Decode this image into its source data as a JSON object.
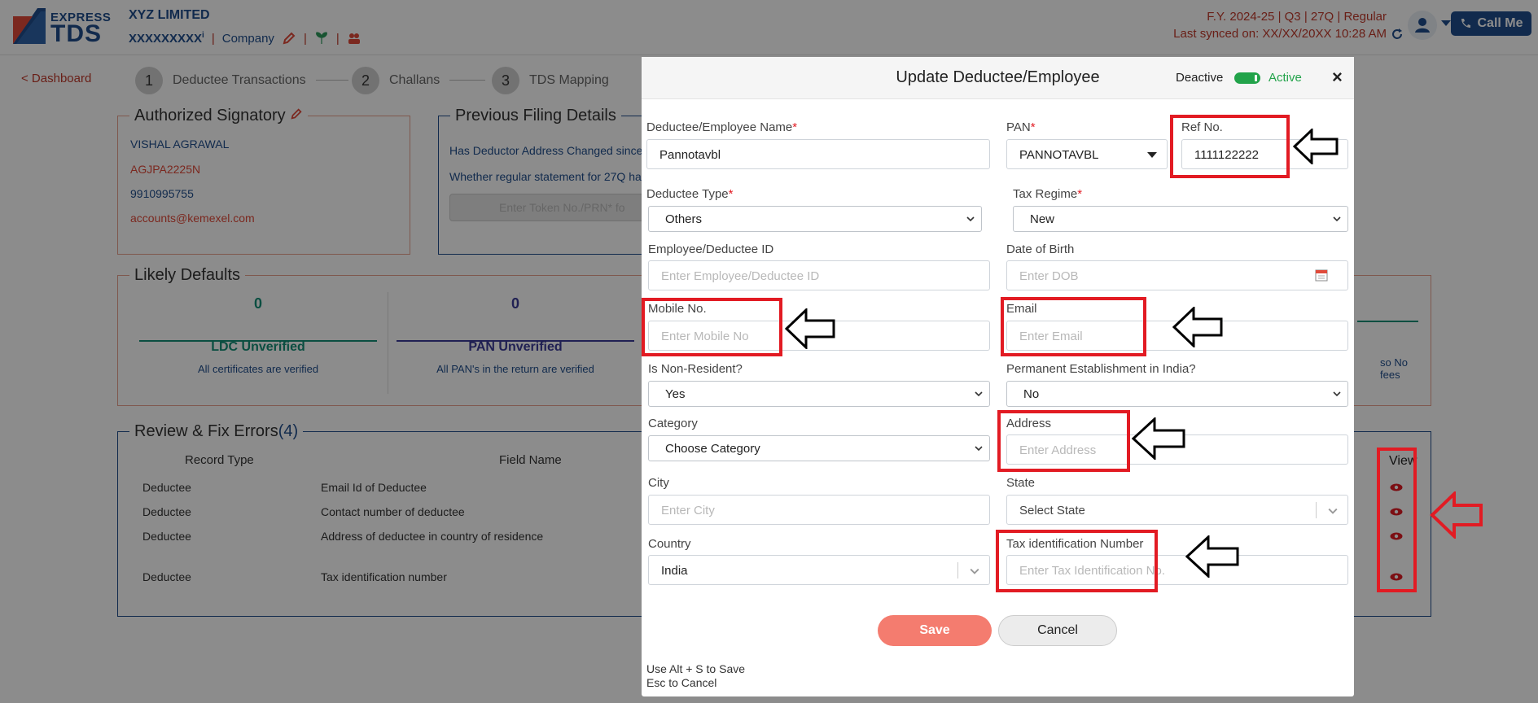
{
  "header": {
    "logo_top": "EXPRESS",
    "logo_bottom": "TDS",
    "company_name": "XYZ LIMITED",
    "tan": "XXXXXXXXX",
    "tan_sup": "i",
    "company_link": "Company",
    "fy_info": "F.Y. 2024-25  | Q3  | 27Q | Regular",
    "last_synced": "Last synced on: XX/XX/20XX 10:28 AM",
    "call_me": "Call Me"
  },
  "nav": {
    "back": "< Dashboard",
    "steps": [
      {
        "num": "1",
        "label": "Deductee Transactions"
      },
      {
        "num": "2",
        "label": "Challans"
      },
      {
        "num": "3",
        "label": "TDS Mapping"
      }
    ]
  },
  "authorized": {
    "title": "Authorized Signatory",
    "name": "VISHAL AGRAWAL",
    "pan": "AGJPA2225N",
    "phone": "9910995755",
    "email": "accounts@kemexel.com"
  },
  "previous": {
    "title": "Previous Filing Details",
    "q1": "Has Deductor Address Changed since",
    "q2": "Whether regular statement for 27Q ha",
    "token_placeholder": "Enter Token No./PRN* fo"
  },
  "likely": {
    "title": "Likely Defaults",
    "stats": [
      {
        "count": "0",
        "title": "LDC Unverified",
        "desc": "All certificates are verified",
        "color": "#148f77"
      },
      {
        "count": "0",
        "title": "PAN Unverified",
        "desc": "All PAN's in the return are verified",
        "color": "#3b3b98"
      }
    ],
    "right_fragment": "so No fees"
  },
  "review": {
    "title": "Review & Fix Errors",
    "count": "(4)",
    "col_record": "Record Type",
    "col_field": "Field Name",
    "col_view": "View",
    "rows": [
      {
        "type": "Deductee",
        "field": "Email Id of Deductee"
      },
      {
        "type": "Deductee",
        "field": "Contact number of deductee"
      },
      {
        "type": "Deductee",
        "field": "Address of deductee in country of residence"
      },
      {
        "type": "Deductee",
        "field": "Tax identification number"
      }
    ]
  },
  "modal": {
    "title": "Update Deductee/Employee",
    "deactive": "Deactive",
    "active": "Active",
    "close": "×",
    "name_label": "Deductee/Employee Name",
    "name_value": "Pannotavbl",
    "pan_label": "PAN",
    "pan_value": "PANNOTAVBL",
    "ref_label": "Ref No.",
    "ref_value": "1111122222",
    "type_label": "Deductee Type",
    "type_value": "Others",
    "regime_label": "Tax Regime",
    "regime_value": "New",
    "empid_label": "Employee/Deductee ID",
    "empid_placeholder": "Enter Employee/Deductee ID",
    "dob_label": "Date of Birth",
    "dob_placeholder": "Enter DOB",
    "mobile_label": "Mobile No.",
    "mobile_placeholder": "Enter Mobile No",
    "email_label": "Email",
    "email_placeholder": "Enter Email",
    "nonres_label": "Is Non-Resident?",
    "nonres_value": "Yes",
    "pe_label": "Permanent Establishment in India?",
    "pe_value": "No",
    "category_label": "Category",
    "category_value": "Choose Category",
    "address_label": "Address",
    "address_placeholder": "Enter Address",
    "city_label": "City",
    "city_placeholder": "Enter City",
    "state_label": "State",
    "state_value": "Select State",
    "country_label": "Country",
    "country_value": "India",
    "tin_label": "Tax identification Number",
    "tin_placeholder": "Enter Tax Identification No.",
    "save": "Save",
    "cancel": "Cancel",
    "hint_save": "Use Alt + S to Save",
    "hint_cancel": "Esc to Cancel",
    "required_mark": "*"
  },
  "colors": {
    "brand": "#1f4e8c",
    "accent_red": "#c0392b",
    "annotation_red": "#e21b23",
    "active_green": "#22a34a",
    "save_button": "#f47c6f"
  },
  "icons": [
    "info-icon",
    "pencil-icon",
    "leaf-icon",
    "team-icon",
    "refresh-icon",
    "user-icon",
    "phone-icon",
    "calendar-icon",
    "chevron-down-icon",
    "eye-icon",
    "arrow-left-icon"
  ]
}
